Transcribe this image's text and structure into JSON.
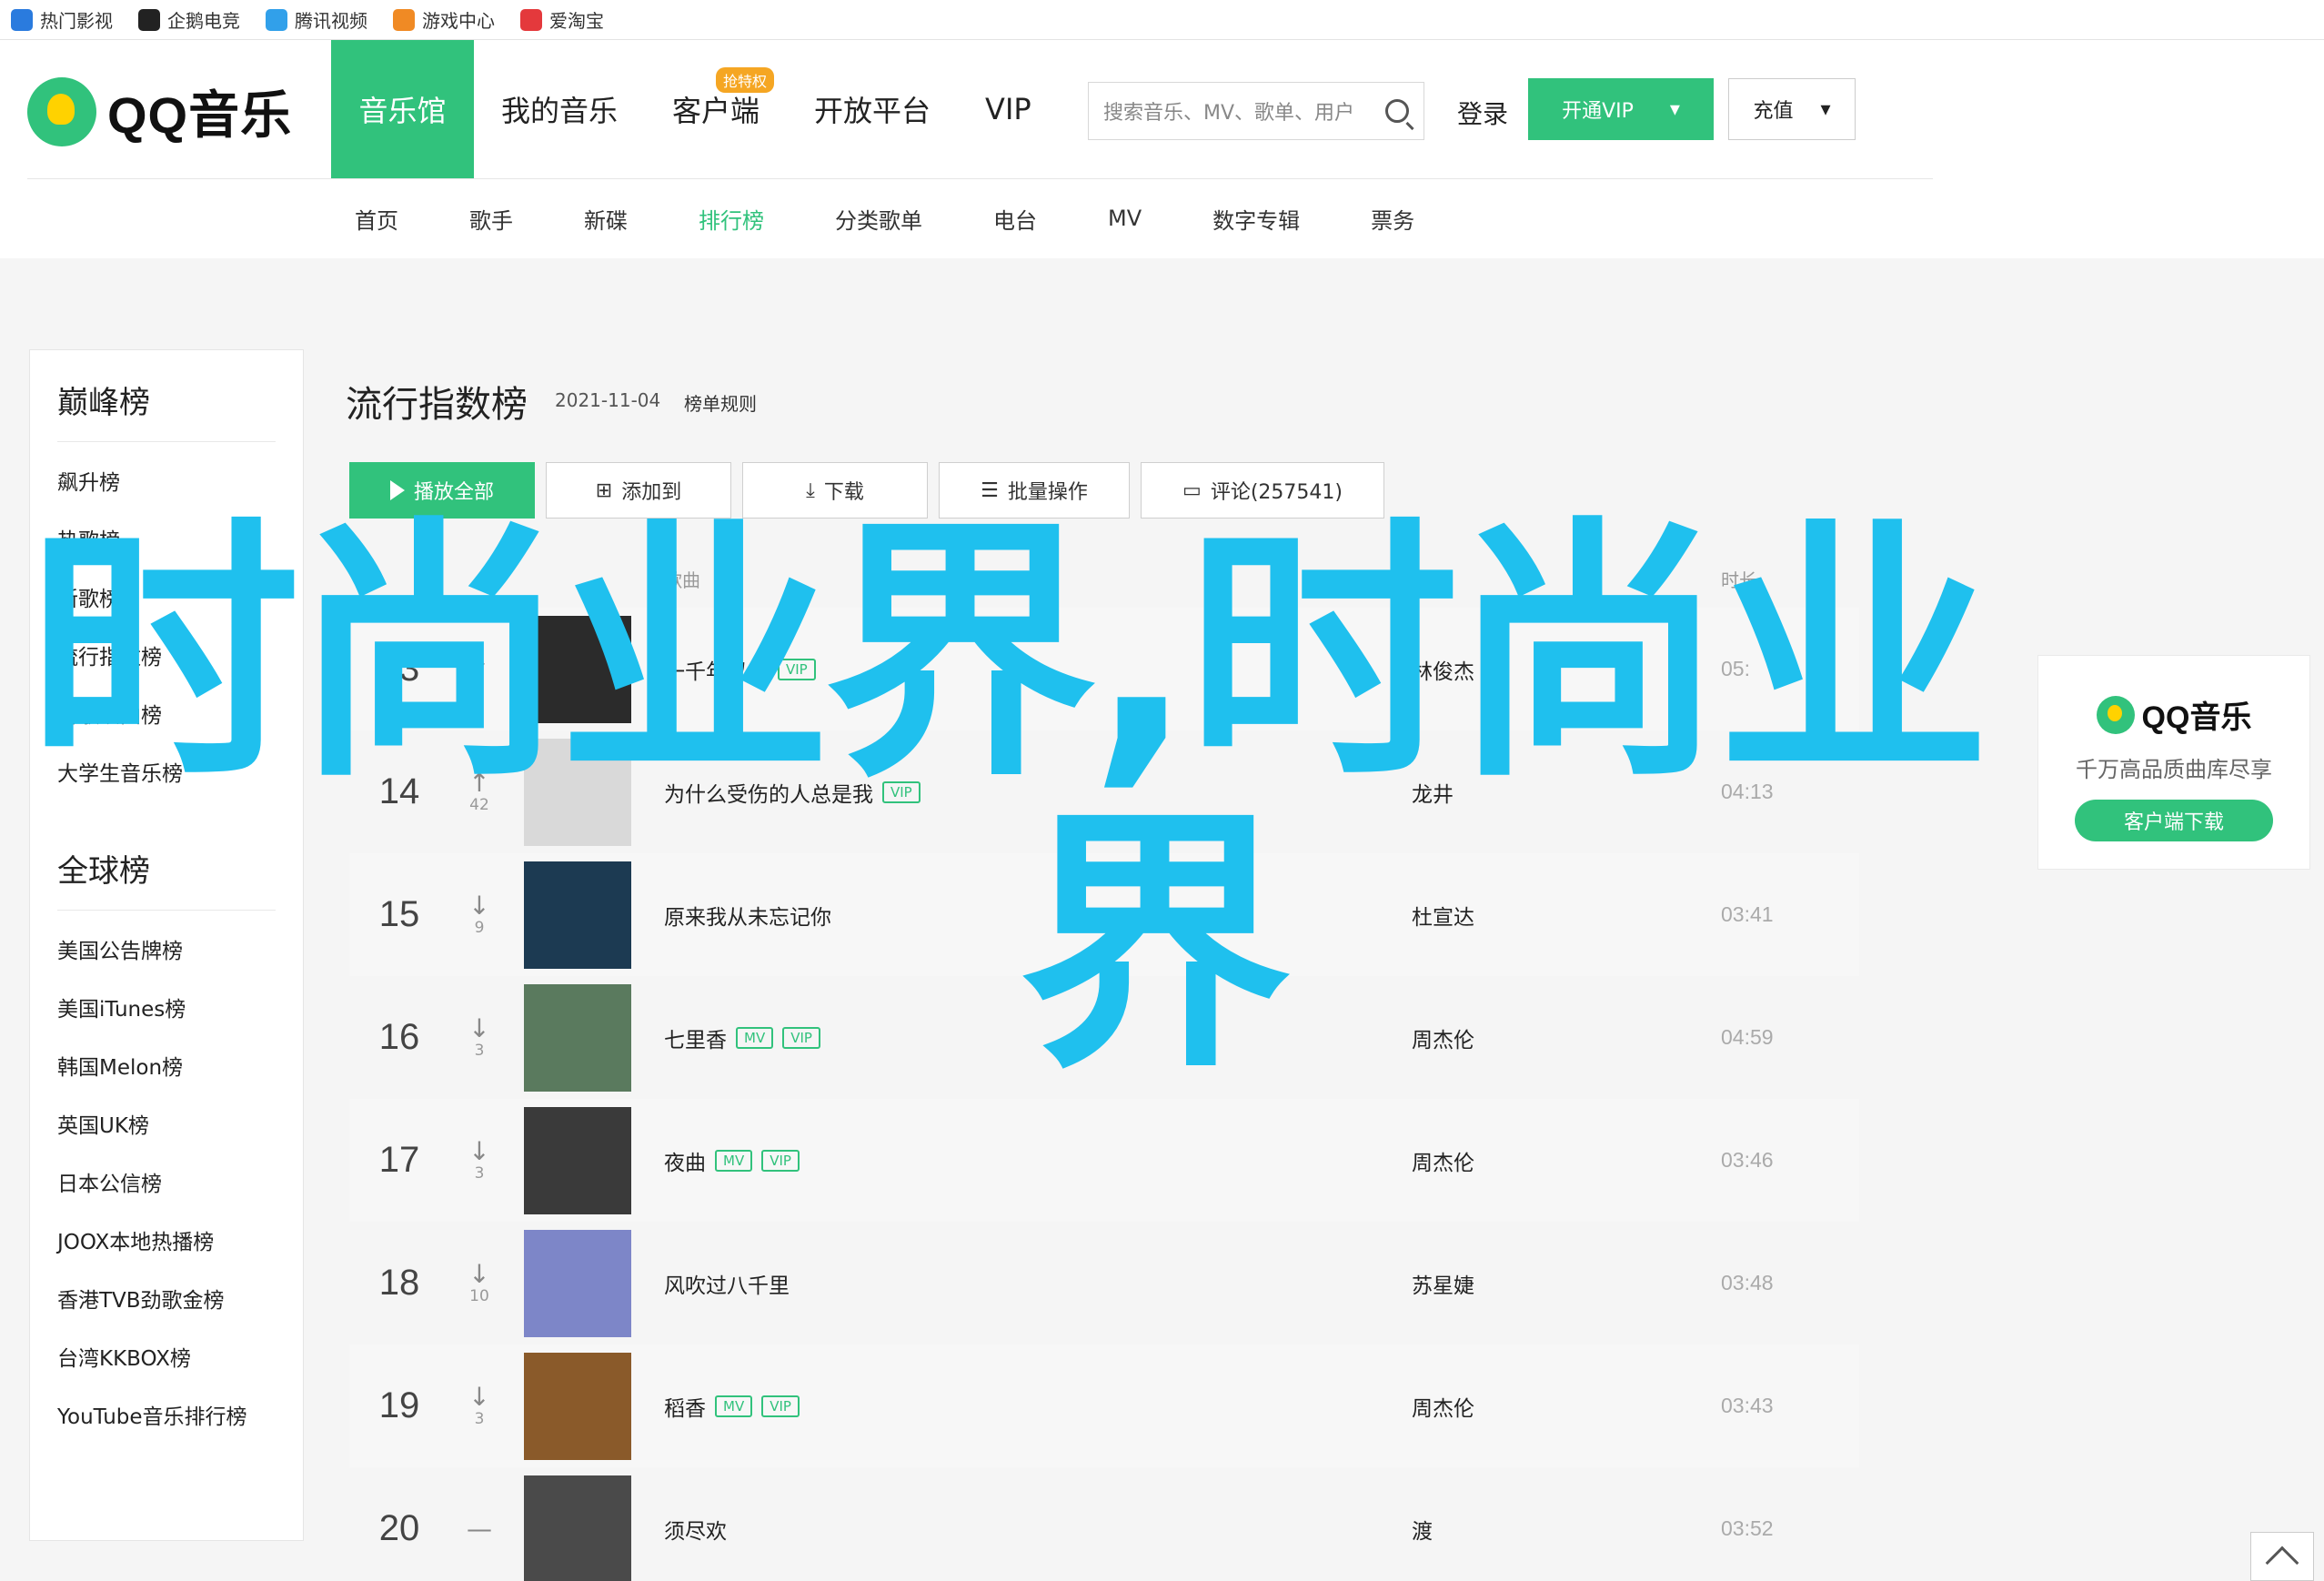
{
  "bookmarks": [
    {
      "label": "热门影视",
      "icon": "video-icon",
      "color": "#2a7bde"
    },
    {
      "label": "企鹅电竞",
      "icon": "penguin-icon",
      "color": "#222222"
    },
    {
      "label": "腾讯视频",
      "icon": "play-icon",
      "color": "#31a0ea"
    },
    {
      "label": "游戏中心",
      "icon": "game-icon",
      "color": "#f08a24"
    },
    {
      "label": "爱淘宝",
      "icon": "taobao-icon",
      "color": "#e4393c"
    }
  ],
  "header": {
    "logo_text": "QQ音乐",
    "nav": [
      "音乐馆",
      "我的音乐",
      "客户端",
      "开放平台",
      "VIP"
    ],
    "hot_badge": "抢特权",
    "search_placeholder": "搜索音乐、MV、歌单、用户",
    "login": "登录",
    "vip_button": "开通VIP",
    "charge_button": "充值",
    "subnav": [
      "首页",
      "歌手",
      "新碟",
      "排行榜",
      "分类歌单",
      "电台",
      "MV",
      "数字专辑",
      "票务"
    ],
    "active_subnav": "排行榜"
  },
  "sidebar": {
    "section1_title": "巅峰榜",
    "section1_items": [
      "飙升榜",
      "热歌榜",
      "新歌榜",
      "流行指数榜",
      "听歌识曲榜",
      "大学生音乐榜"
    ],
    "section2_title": "全球榜",
    "section2_items": [
      "美国公告牌榜",
      "美国iTunes榜",
      "韩国Melon榜",
      "英国UK榜",
      "日本公信榜",
      "JOOX本地热播榜",
      "香港TVB劲歌金榜",
      "台湾KKBOX榜",
      "YouTube音乐排行榜"
    ]
  },
  "main": {
    "title": "流行指数榜",
    "date": "2021-11-04",
    "rules": "榜单规则",
    "actions": [
      "播放全部",
      "添加到",
      "下载",
      "批量操作",
      "评论(257541)"
    ],
    "col_song": "歌曲",
    "col_artist": "歌手",
    "col_time": "时长"
  },
  "rows": [
    {
      "rank": "13",
      "trend": "↑",
      "change": "",
      "song": "一千年以后",
      "mv": false,
      "vip": true,
      "artist": "林俊杰",
      "duration": "05:",
      "cover": "#2b2b2b"
    },
    {
      "rank": "14",
      "trend": "↑",
      "change": "42",
      "song": "为什么受伤的人总是我",
      "mv": false,
      "vip": true,
      "artist": "龙井",
      "duration": "04:13",
      "cover": "#d9d9d9"
    },
    {
      "rank": "15",
      "trend": "↓",
      "change": "9",
      "song": "原来我从未忘记你",
      "mv": false,
      "vip": false,
      "artist": "杜宣达",
      "duration": "03:41",
      "cover": "#1c3a52"
    },
    {
      "rank": "16",
      "trend": "↓",
      "change": "3",
      "song": "七里香",
      "mv": true,
      "vip": true,
      "artist": "周杰伦",
      "duration": "04:59",
      "cover": "#5a7a5e"
    },
    {
      "rank": "17",
      "trend": "↓",
      "change": "3",
      "song": "夜曲",
      "mv": true,
      "vip": true,
      "artist": "周杰伦",
      "duration": "03:46",
      "cover": "#3a3a3a"
    },
    {
      "rank": "18",
      "trend": "↓",
      "change": "10",
      "song": "风吹过八千里",
      "mv": false,
      "vip": false,
      "artist": "苏星婕",
      "duration": "03:48",
      "cover": "#7d86c8"
    },
    {
      "rank": "19",
      "trend": "↓",
      "change": "3",
      "song": "稻香",
      "mv": true,
      "vip": true,
      "artist": "周杰伦",
      "duration": "03:43",
      "cover": "#8a5a2a"
    },
    {
      "rank": "20",
      "trend": "—",
      "change": "",
      "song": "须尽欢",
      "mv": false,
      "vip": false,
      "artist": "渡",
      "duration": "03:52",
      "cover": "#4a4a4a"
    }
  ],
  "tags": {
    "mv": "MV",
    "vip": "VIP"
  },
  "overlay": {
    "line1": "时尚业界,时尚业",
    "line2": "界"
  },
  "float_ad": {
    "logo": "QQ音乐",
    "slogan": "千万高品质曲库尽享",
    "button": "客户端下载"
  },
  "colors": {
    "accent": "#31c27c",
    "overlay": "#1fc0ee"
  }
}
